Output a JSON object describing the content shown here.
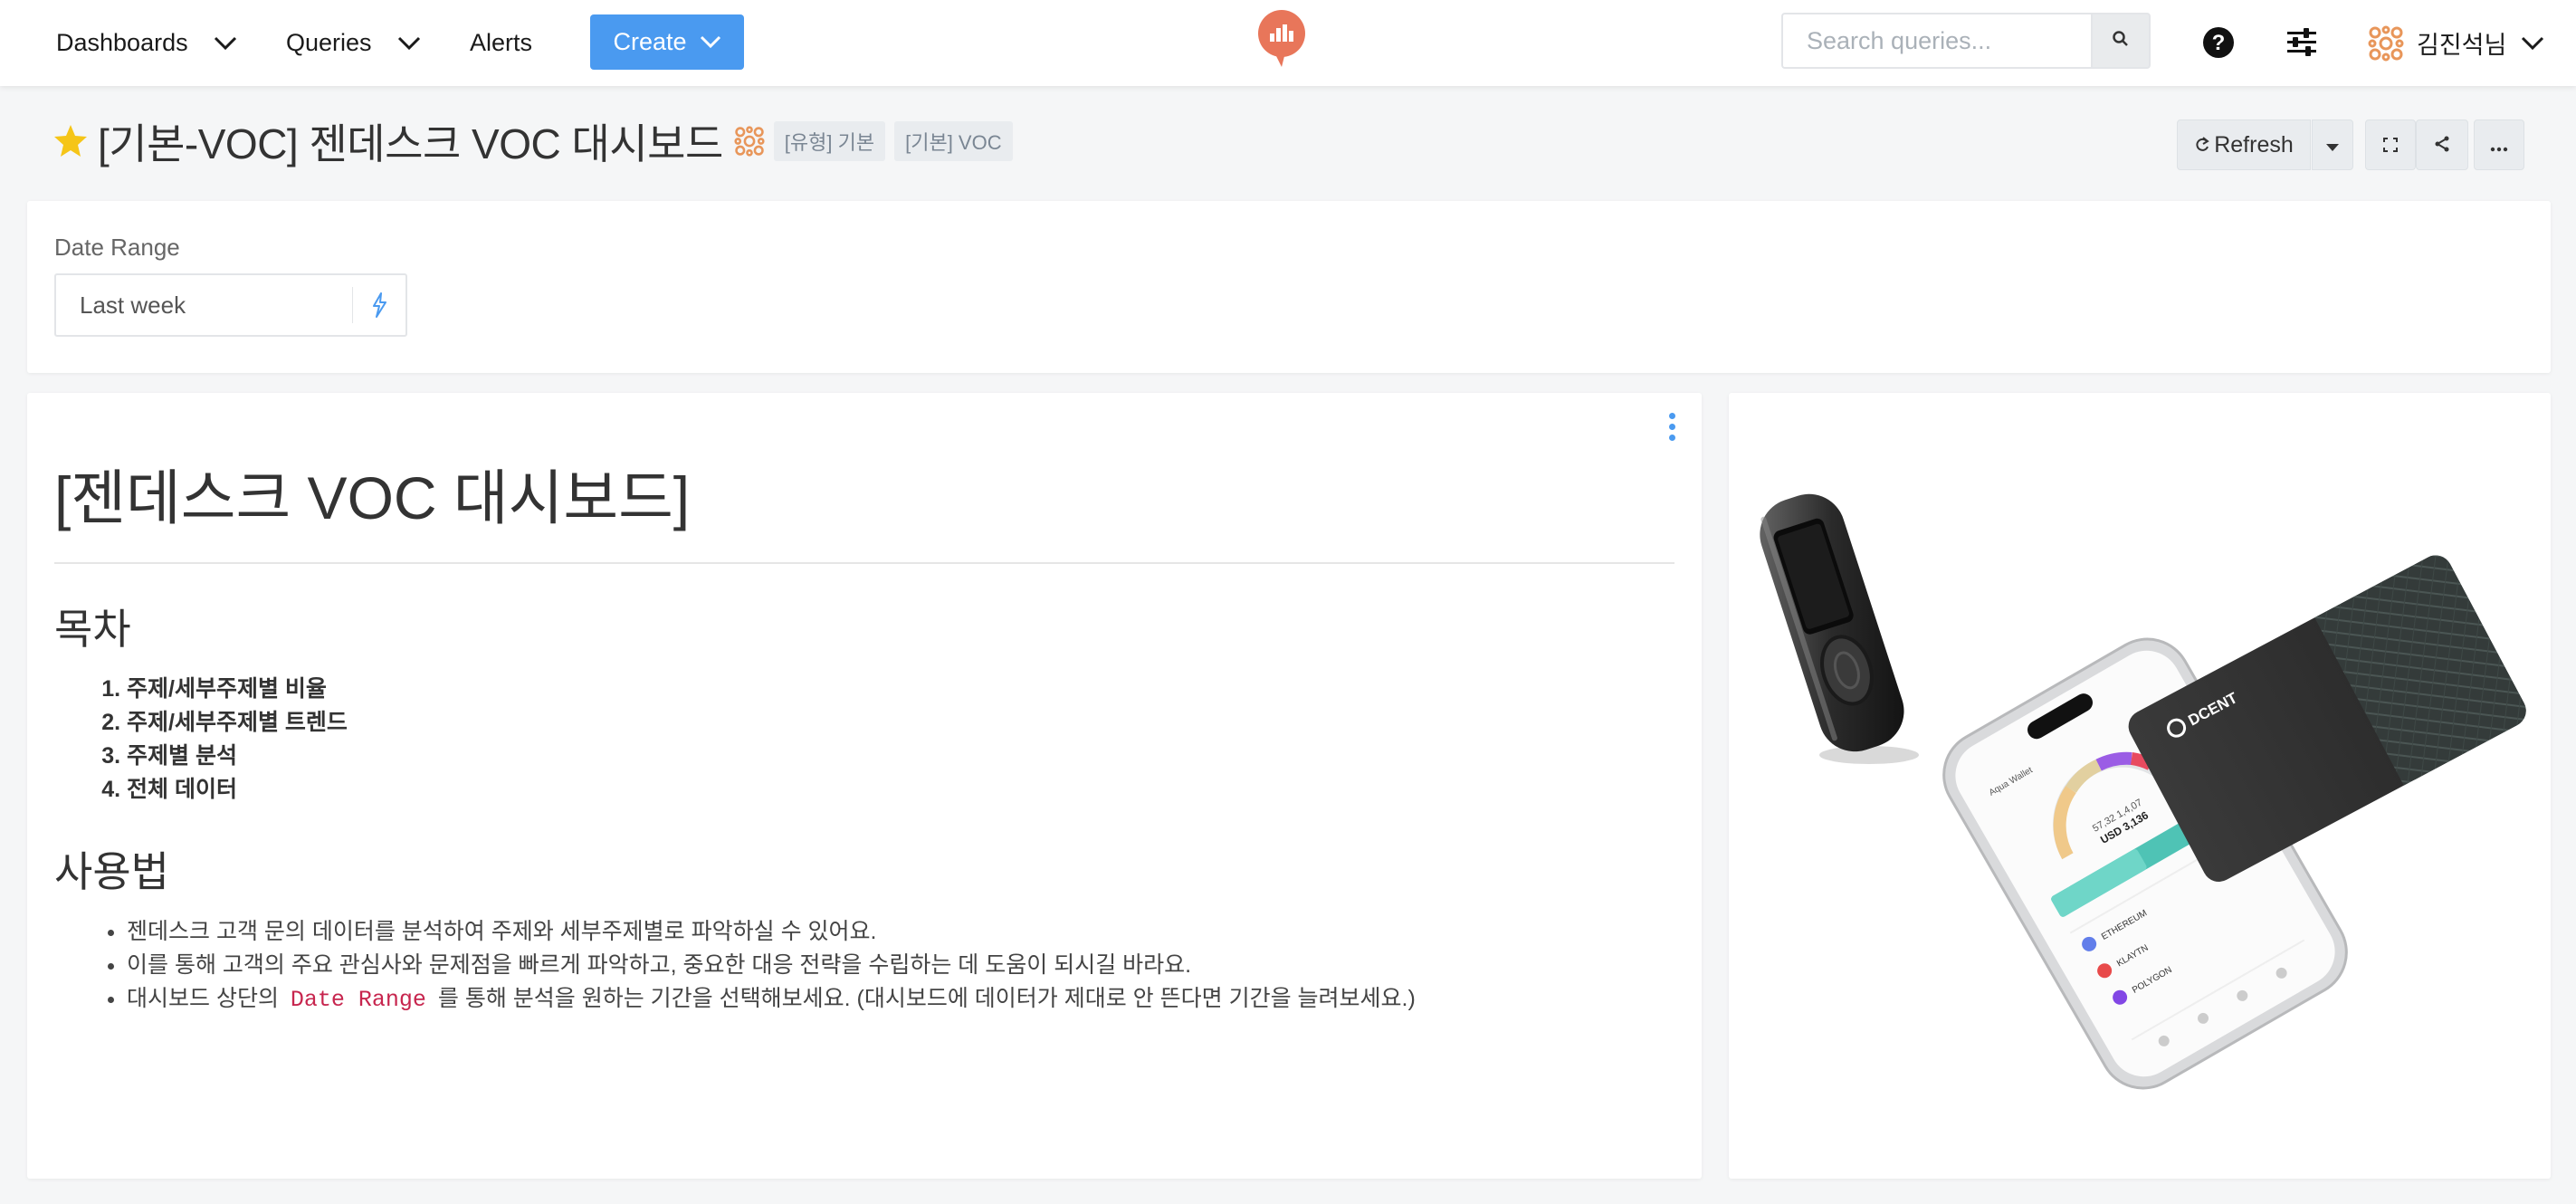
{
  "nav": {
    "dashboards": "Dashboards",
    "queries": "Queries",
    "alerts": "Alerts",
    "create": "Create",
    "search_placeholder": "Search queries...",
    "user_name": "김진석님"
  },
  "dashboard": {
    "title": "[기본-VOC] 젠데스크 VOC 대시보드",
    "tags": [
      "[유형] 기본",
      "[기본] VOC"
    ],
    "refresh_label": "Refresh"
  },
  "filters": {
    "date_range_label": "Date Range",
    "date_range_value": "Last week"
  },
  "text_widget": {
    "heading": "[젠데스크 VOC 대시보드]",
    "toc_heading": "목차",
    "toc": [
      "주제/세부주제별 비율",
      "주제/세부주제별 트렌드",
      "주제별 분석",
      "전체 데이터"
    ],
    "usage_heading": "사용법",
    "usage": [
      "젠데스크 고객 문의 데이터를 분석하여 주제와 세부주제별로 파악하실 수 있어요.",
      "이를 통해 고객의 주요 관심사와 문제점을 빠르게 파악하고, 중요한 대응 전략을 수립하는 데 도움이 되시길 바라요."
    ],
    "usage3_prefix": "대시보드 상단의",
    "usage3_code": "Date Range",
    "usage3_suffix": "를 통해 분석을 원하는 기간을 선택해보세요. (대시보드에 데이터가 제대로 안 뜬다면 기간을 늘려보세요.)"
  },
  "image_widget": {
    "card_brand": "DCENT",
    "phone_balance_line1": "57,32 1,4,07",
    "phone_balance_line2": "USD 3,136",
    "phone_wallet_label": "Aqua Wallet",
    "phone_coins": [
      "ETHEREUM",
      "KLAYTN",
      "POLYGON"
    ],
    "icons": [
      "hardware-wallet",
      "smartphone",
      "card"
    ]
  },
  "colors": {
    "accent": "#4a9af0",
    "logo": "#e8765a",
    "code": "#c7254e",
    "star": "#f5c518"
  },
  "icons": {
    "chevron": "chevron-down-icon",
    "search": "search-icon",
    "help": "help-icon",
    "settings": "sliders-icon",
    "refresh": "refresh-icon",
    "fullscreen": "fullscreen-icon",
    "share": "share-icon",
    "more": "more-icon",
    "bolt": "bolt-icon",
    "star": "star-icon"
  }
}
